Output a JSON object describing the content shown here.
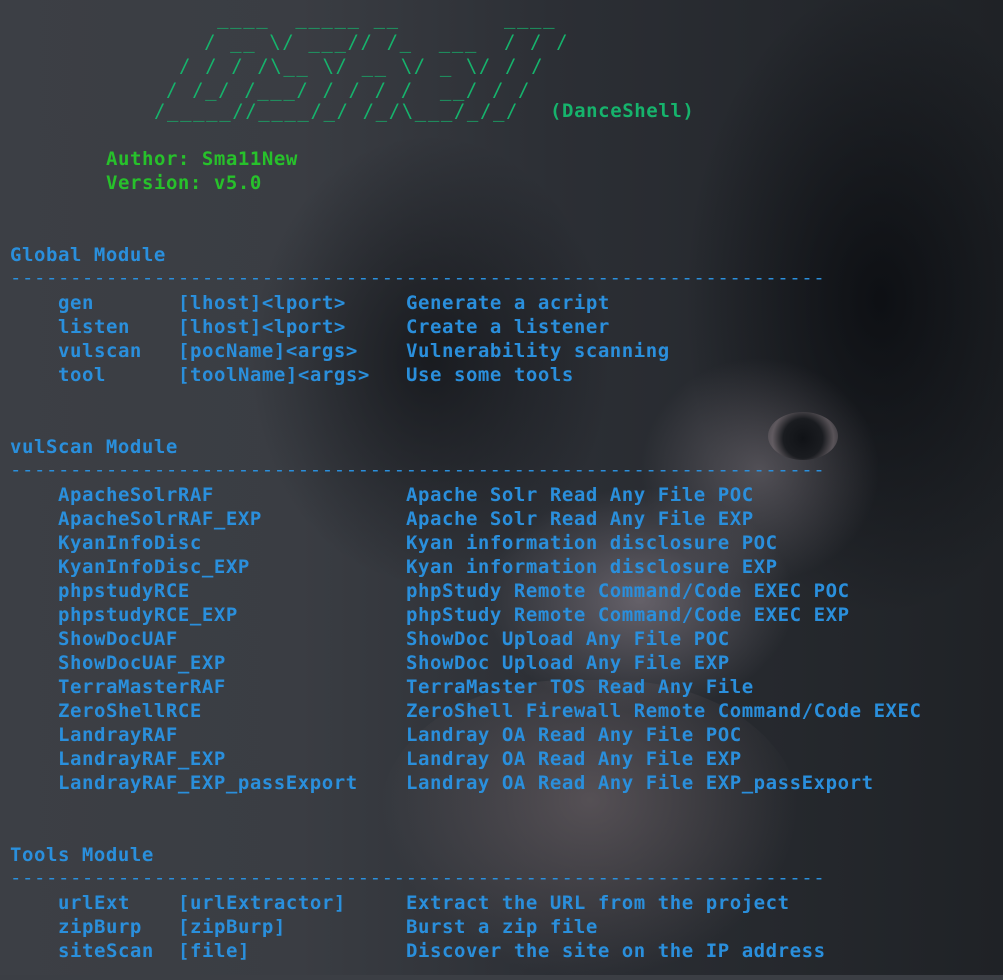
{
  "banner": {
    "lines": [
      "   ____  _____ __        ____",
      "  / __ \\/ ___// /_  ___  / / /",
      " / / / /\\__ \\/ __ \\/ _ \\/ / / ",
      "/ /_/ /___/ / / / /  __/ / /  ",
      "/_____//____/_/ /_/\\___/_/_/   "
    ],
    "subtitle": "(DanceShell)"
  },
  "info": {
    "author": "Author: Sma11New",
    "version": "Version: v5.0"
  },
  "separator": "--------------------------------------------------------------------",
  "global": {
    "title": "Global Module",
    "rows": [
      {
        "cmd": "gen",
        "args": "[lhost]<lport>",
        "desc": "Generate a acript"
      },
      {
        "cmd": "listen",
        "args": "[lhost]<lport>",
        "desc": "Create a listener"
      },
      {
        "cmd": "vulscan",
        "args": "[pocName]<args>",
        "desc": "Vulnerability scanning"
      },
      {
        "cmd": "tool",
        "args": "[toolName]<args>",
        "desc": "Use some tools"
      }
    ]
  },
  "vulscan": {
    "title": "vulScan Module",
    "rows": [
      {
        "name": "ApacheSolrRAF",
        "desc": "Apache Solr Read Any File POC"
      },
      {
        "name": "ApacheSolrRAF_EXP",
        "desc": "Apache Solr Read Any File EXP"
      },
      {
        "name": "KyanInfoDisc",
        "desc": "Kyan information disclosure POC"
      },
      {
        "name": "KyanInfoDisc_EXP",
        "desc": "Kyan information disclosure EXP"
      },
      {
        "name": "phpstudyRCE",
        "desc": "phpStudy Remote Command/Code EXEC POC"
      },
      {
        "name": "phpstudyRCE_EXP",
        "desc": "phpStudy Remote Command/Code EXEC EXP"
      },
      {
        "name": "ShowDocUAF",
        "desc": "ShowDoc Upload Any File POC"
      },
      {
        "name": "ShowDocUAF_EXP",
        "desc": "ShowDoc Upload Any File EXP"
      },
      {
        "name": "TerraMasterRAF",
        "desc": "TerraMaster TOS Read Any File"
      },
      {
        "name": "ZeroShellRCE",
        "desc": "ZeroShell Firewall Remote Command/Code EXEC"
      },
      {
        "name": "LandrayRAF",
        "desc": "Landray OA Read Any File POC"
      },
      {
        "name": "LandrayRAF_EXP",
        "desc": "Landray OA Read Any File EXP"
      },
      {
        "name": "LandrayRAF_EXP_passExport",
        "desc": "Landray OA Read Any File EXP_passExport"
      }
    ]
  },
  "tools": {
    "title": "Tools Module",
    "rows": [
      {
        "cmd": "urlExt",
        "args": "[urlExtractor]",
        "desc": "Extract the URL from the project"
      },
      {
        "cmd": "zipBurp",
        "args": "[zipBurp]",
        "desc": "Burst a zip file"
      },
      {
        "cmd": "siteScan",
        "args": "[file]",
        "desc": "Discover the site on the IP address"
      }
    ]
  },
  "colors": {
    "banner": "#16b36c",
    "info": "#27c12b",
    "module": "#2a8fdc"
  }
}
